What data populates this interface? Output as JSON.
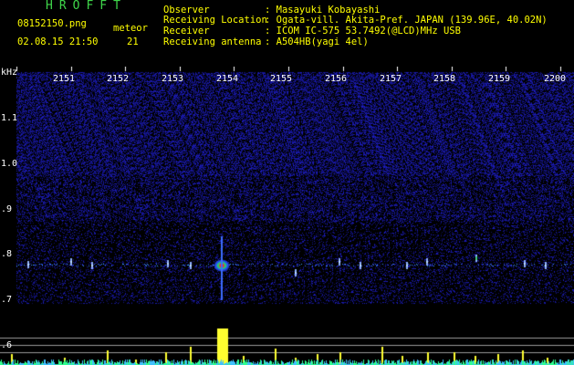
{
  "header": {
    "logo": "HROFFT",
    "filename": "08152150.png",
    "datetime": "02.08.15 21:50",
    "meteor_label": "meteor",
    "meteor_count": "21",
    "fields": [
      {
        "label": "Observer",
        "value": ": Masayuki Kobayashi"
      },
      {
        "label": "Receiving Location",
        "value": ": Ogata-vill. Akita-Pref. JAPAN (139.96E, 40.02N)"
      },
      {
        "label": "Receiver",
        "value": ": ICOM IC-575 53.7492(@LCD)MHz USB"
      },
      {
        "label": "Receiving antenna",
        "value": ": A504HB(yagi 4el)"
      }
    ]
  },
  "axes": {
    "y_unit": "kHz",
    "y_ticks": [
      "1.1",
      "1.0",
      ".9",
      ".8",
      ".7",
      ".6"
    ],
    "x_ticks": [
      "2151",
      "2152",
      "2153",
      "2154",
      "2155",
      "2156",
      "2157",
      "2158",
      "2159",
      "2200"
    ]
  },
  "colors": {
    "background": "#000000",
    "noise": "#1a1a9a",
    "signal_band": "#3c6cff",
    "echo_core": "#ff2020",
    "echo_halo": "#20c060",
    "meter": "#ffff30",
    "meter_base": "#40c0ff",
    "header_green": "#3fd64a",
    "header_yellow": "#ffff00"
  }
}
